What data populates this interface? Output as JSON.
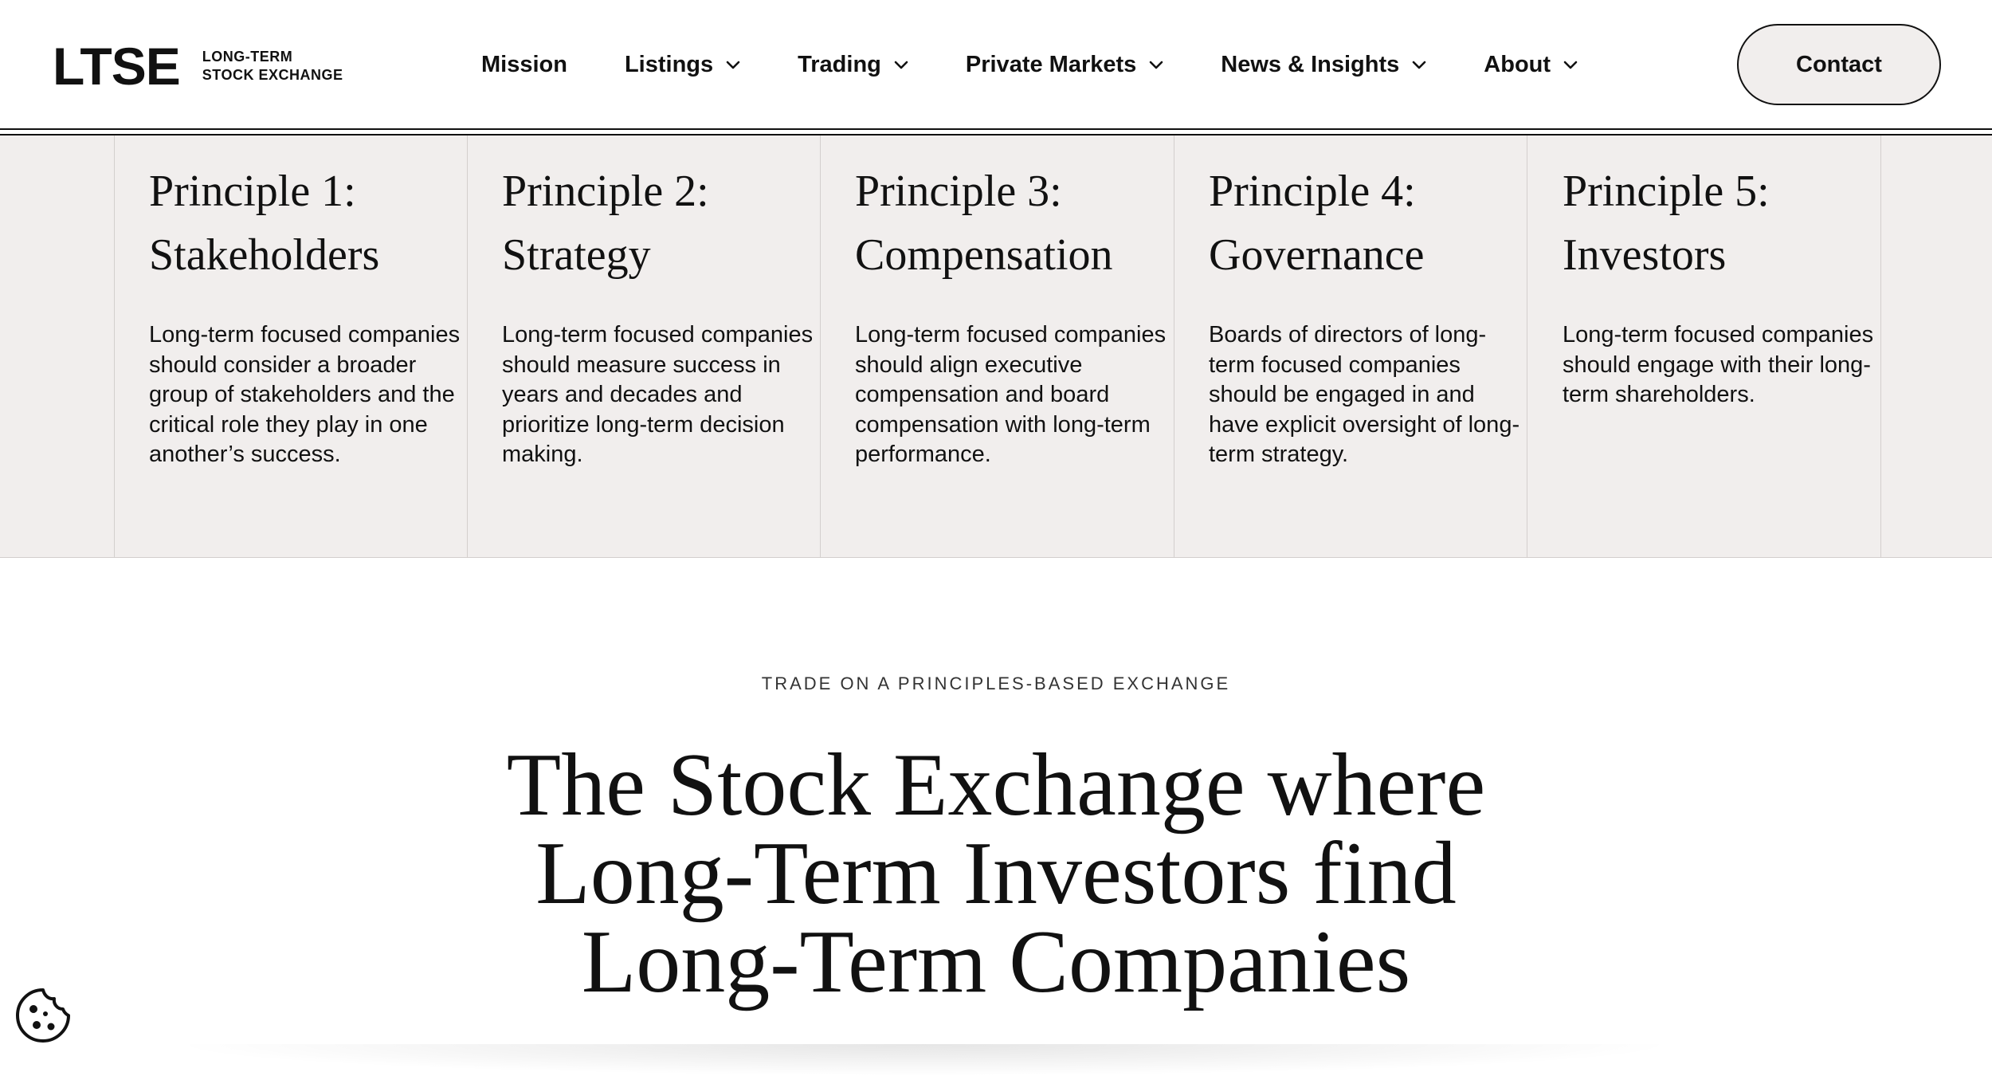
{
  "header": {
    "logo": {
      "mark": "LTSE",
      "line1": "LONG-TERM",
      "line2": "STOCK EXCHANGE"
    },
    "nav": [
      {
        "label": "Mission",
        "has_dropdown": false
      },
      {
        "label": "Listings",
        "has_dropdown": true
      },
      {
        "label": "Trading",
        "has_dropdown": true
      },
      {
        "label": "Private Markets",
        "has_dropdown": true
      },
      {
        "label": "News & Insights",
        "has_dropdown": true
      },
      {
        "label": "About",
        "has_dropdown": true
      }
    ],
    "contact_label": "Contact"
  },
  "principles": [
    {
      "title_line1": "Principle 1:",
      "title_line2": "Stakeholders",
      "text": "Long-term focused companies should consider a broader group of stakeholders and the critical role they play in one another’s success."
    },
    {
      "title_line1": "Principle 2:",
      "title_line2": "Strategy",
      "text": "Long-term focused companies should measure success in years and decades and prioritize long-term decision making."
    },
    {
      "title_line1": "Principle 3:",
      "title_line2": "Compensation",
      "text": "Long-term focused companies should align executive compensation and board compensation with long-term performance."
    },
    {
      "title_line1": "Principle 4:",
      "title_line2": "Governance",
      "text": "Boards of directors of long-term focused companies should be engaged in and have explicit oversight of long-term strategy."
    },
    {
      "title_line1": "Principle 5:",
      "title_line2": "Investors",
      "text": "Long-term focused companies should engage with their long-term shareholders."
    }
  ],
  "hero": {
    "eyebrow": "TRADE ON A PRINCIPLES-BASED EXCHANGE",
    "title_line1": "The Stock Exchange where",
    "title_line2": "Long-Term Investors find",
    "title_line3": "Long-Term Companies"
  },
  "icons": {
    "chevron": "chevron-down-icon",
    "cookie": "cookie-icon"
  },
  "colors": {
    "band_background": "#f1eeed",
    "text": "#111111",
    "divider": "#d3cfcd"
  }
}
